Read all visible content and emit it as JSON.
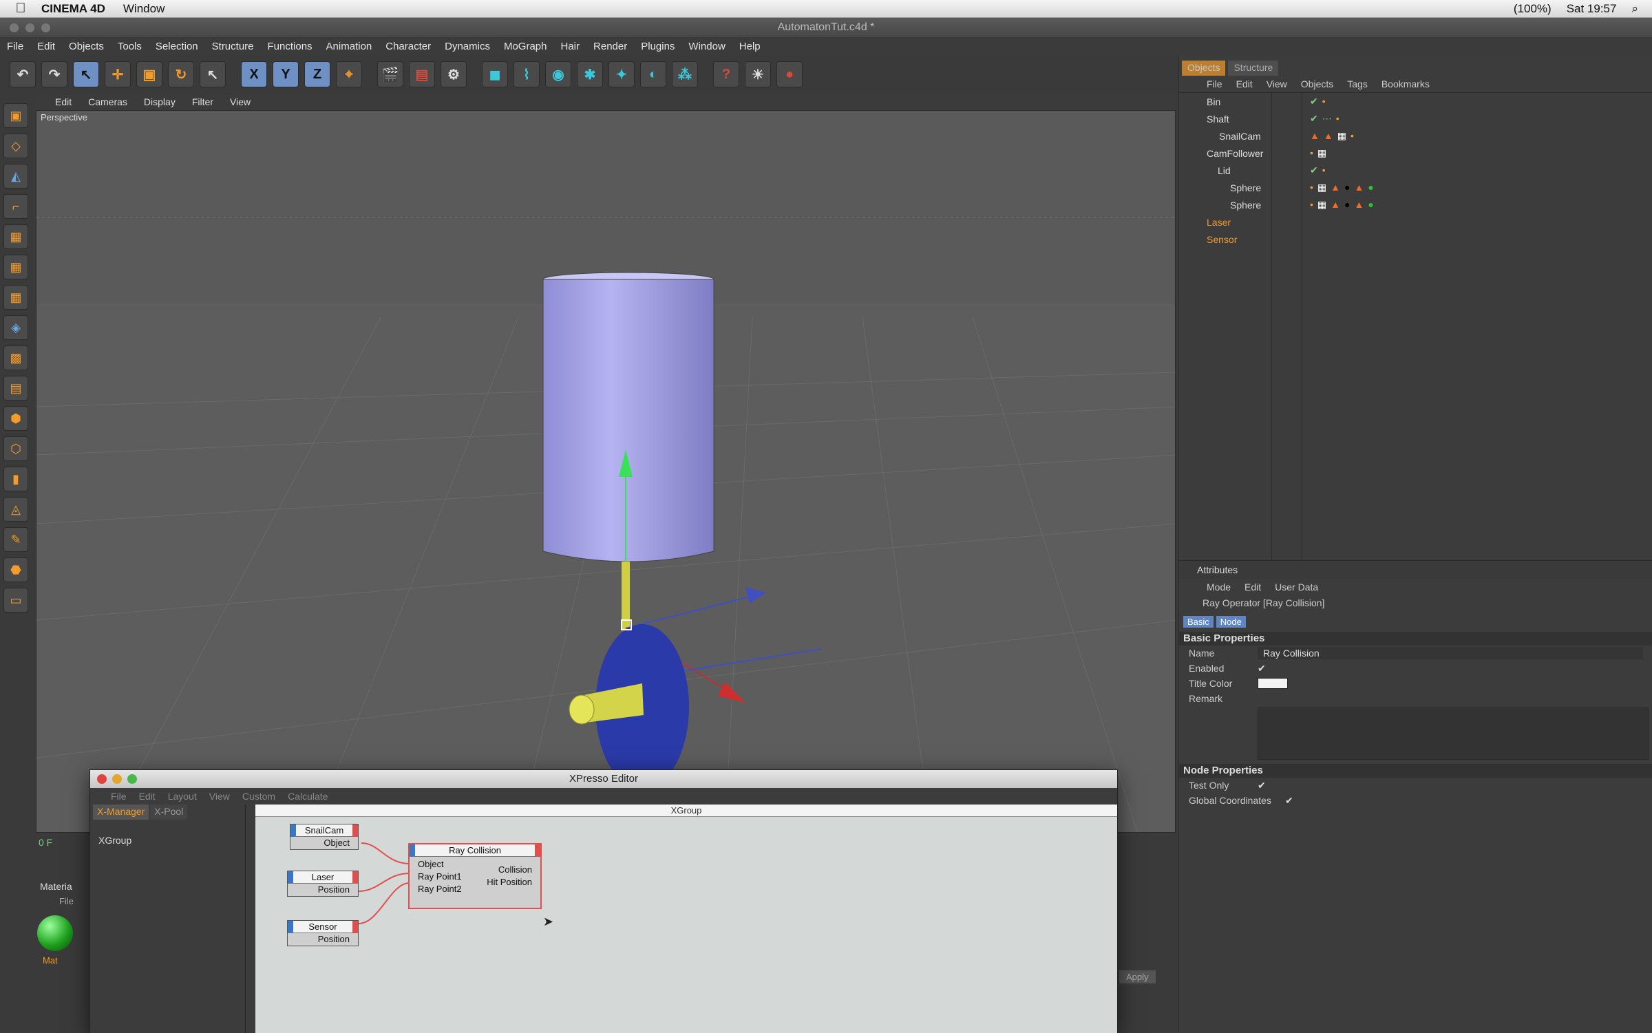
{
  "mac": {
    "apple": "",
    "app": "CINEMA 4D",
    "menu": "Window",
    "battery": "(100%)",
    "clock": "Sat 19:57"
  },
  "window": {
    "title": "AutomatonTut.c4d *"
  },
  "menu": [
    "File",
    "Edit",
    "Objects",
    "Tools",
    "Selection",
    "Structure",
    "Functions",
    "Animation",
    "Character",
    "Dynamics",
    "MoGraph",
    "Hair",
    "Render",
    "Plugins",
    "Window",
    "Help"
  ],
  "viewport": {
    "menu": [
      "Edit",
      "Cameras",
      "Display",
      "Filter",
      "View"
    ],
    "label": "Perspective"
  },
  "toolbar": {
    "undo": "↶",
    "redo": "↷",
    "select": "↖",
    "move": "✛",
    "scale": "▣",
    "rotate": "↻",
    "live": "↖",
    "x": "X",
    "y": "Y",
    "z": "Z",
    "world": "⌖",
    "render_view": "🎬",
    "render_region": "▤",
    "render_settings": "⚙",
    "cube": "◼",
    "spline": "⌇",
    "nurbs": "◉",
    "array": "✱",
    "deformer": "✦",
    "scene": "◐",
    "env": "⁂",
    "camera": "?",
    "light": "☀",
    "record": "●"
  },
  "lefttools": [
    "▣",
    "◇",
    "◭",
    "⌐",
    "▦",
    "▦",
    "▦",
    "◈",
    "▩",
    "▤",
    "⬢",
    "⬡",
    "▮",
    "◬",
    "✎",
    "⬣",
    "▭"
  ],
  "objects_panel": {
    "tabs": [
      "Objects",
      "Structure"
    ],
    "menu": [
      "File",
      "Edit",
      "View",
      "Objects",
      "Tags",
      "Bookmarks"
    ],
    "rows": [
      {
        "name": "Bin",
        "indent": 0,
        "tags": [
          "✔",
          "•"
        ]
      },
      {
        "name": "Shaft",
        "indent": 0,
        "tags": [
          "✔",
          "⋯",
          "•"
        ]
      },
      {
        "name": "SnailCam",
        "indent": 1,
        "tags": [
          "▲",
          "▲",
          "▦",
          "•"
        ]
      },
      {
        "name": "CamFollower",
        "indent": 0,
        "tags": [
          "•",
          "▦"
        ]
      },
      {
        "name": "Lid",
        "indent": 1,
        "tags": [
          "✔",
          "•"
        ]
      },
      {
        "name": "Sphere",
        "indent": 2,
        "tags": [
          "•",
          "▦",
          "▲",
          "●",
          "▲",
          "●"
        ]
      },
      {
        "name": "Sphere",
        "indent": 2,
        "tags": [
          "•",
          "▦",
          "▲",
          "●",
          "▲",
          "●"
        ]
      },
      {
        "name": "Laser",
        "indent": 0,
        "tags": [],
        "orange": true
      },
      {
        "name": "Sensor",
        "indent": 0,
        "tags": [],
        "orange": true
      }
    ]
  },
  "attributes": {
    "title": "Attributes",
    "menu": [
      "Mode",
      "Edit",
      "User Data"
    ],
    "object": "Ray Operator [Ray Collision]",
    "tabs": [
      "Basic",
      "Node"
    ],
    "basic_header": "Basic Properties",
    "name_label": "Name",
    "name_value": "Ray Collision",
    "enabled_label": "Enabled",
    "title_color_label": "Title Color",
    "remark_label": "Remark",
    "node_header": "Node Properties",
    "test_only_label": "Test Only",
    "global_coords_label": "Global Coordinates",
    "check": "✔"
  },
  "xpresso": {
    "title": "XPresso Editor",
    "menu": [
      "File",
      "Edit",
      "Layout",
      "View",
      "Custom",
      "Calculate"
    ],
    "tabs": [
      "X-Manager",
      "X-Pool"
    ],
    "group_item": "XGroup",
    "canvas_title": "XGroup",
    "nodes": {
      "snailcam": {
        "title": "SnailCam",
        "port": "Object"
      },
      "laser": {
        "title": "Laser",
        "port": "Position"
      },
      "sensor": {
        "title": "Sensor",
        "port": "Position"
      },
      "ray": {
        "title": "Ray Collision",
        "in": [
          "Object",
          "Ray Point1",
          "Ray Point2"
        ],
        "out": [
          "Collision",
          "Hit Position"
        ]
      }
    }
  },
  "bottom": {
    "frame": "0 F",
    "material_title": "Materia",
    "material_menu": "File",
    "material_name": "Mat",
    "apply": "Apply"
  },
  "colors": {
    "accent": "#f39c2a",
    "cylinder": "#a9a7e8",
    "disc": "#2a3aa8",
    "shaft": "#d4d44a",
    "selection": "#6e90c4"
  }
}
